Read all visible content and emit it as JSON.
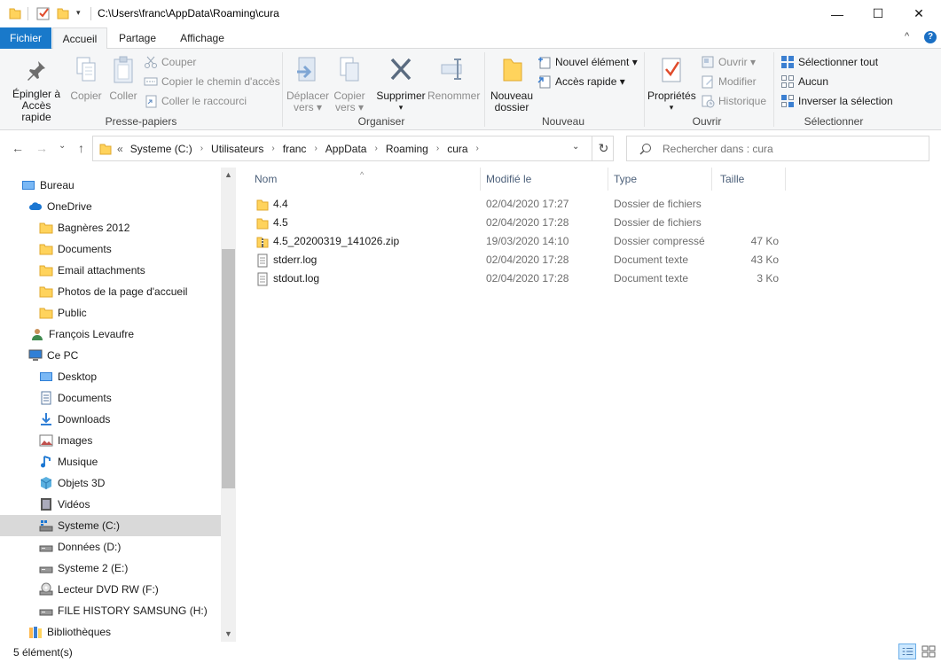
{
  "window": {
    "title": "C:\\Users\\franc\\AppData\\Roaming\\cura",
    "qa_dropdown": "▾",
    "minimize": "—",
    "maximize": "☐",
    "close": "✕"
  },
  "ribbon_tabs": {
    "file": "Fichier",
    "home": "Accueil",
    "share": "Partage",
    "view": "Affichage",
    "collapse": "^",
    "help": "?"
  },
  "ribbon": {
    "clipboard": {
      "label": "Presse-papiers",
      "pin_line1": "Épingler à",
      "pin_line2": "Accès rapide",
      "copy": "Copier",
      "paste": "Coller",
      "cut": "Couper",
      "copy_path": "Copier le chemin d'accès",
      "paste_shortcut": "Coller le raccourci"
    },
    "organize": {
      "label": "Organiser",
      "move_line1": "Déplacer",
      "move_line2": "vers ▾",
      "copyto_line1": "Copier",
      "copyto_line2": "vers ▾",
      "delete": "Supprimer",
      "delete_arrow": "▾",
      "rename": "Renommer"
    },
    "new": {
      "label": "Nouveau",
      "new_folder_line1": "Nouveau",
      "new_folder_line2": "dossier",
      "new_item": "Nouvel élément ▾",
      "easy_access": "Accès rapide ▾"
    },
    "open": {
      "label": "Ouvrir",
      "properties": "Propriétés",
      "properties_arrow": "▾",
      "open": "Ouvrir ▾",
      "edit": "Modifier",
      "history": "Historique"
    },
    "select": {
      "label": "Sélectionner",
      "select_all": "Sélectionner tout",
      "select_none": "Aucun",
      "invert": "Inverser la sélection"
    }
  },
  "nav": {
    "back": "←",
    "forward": "→",
    "recent": "⌄",
    "up": "↑",
    "overflow": "«",
    "crumbs": [
      "Systeme (C:)",
      "Utilisateurs",
      "franc",
      "AppData",
      "Roaming",
      "cura"
    ],
    "crumb_sep": "›",
    "dropdown": "⌄",
    "refresh": "↻",
    "search_placeholder": "Rechercher dans : cura"
  },
  "sidebar": {
    "items": [
      {
        "label": "Bureau",
        "icon": "desktop-icon"
      },
      {
        "label": "OneDrive",
        "icon": "cloud-icon"
      },
      {
        "label": "Bagnères 2012",
        "icon": "folder-icon"
      },
      {
        "label": "Documents",
        "icon": "folder-icon"
      },
      {
        "label": "Email attachments",
        "icon": "folder-icon"
      },
      {
        "label": "Photos de la page d'accueil",
        "icon": "folder-icon"
      },
      {
        "label": "Public",
        "icon": "folder-icon"
      },
      {
        "label": "François Levaufre",
        "icon": "user-icon"
      },
      {
        "label": "Ce PC",
        "icon": "computer-icon"
      },
      {
        "label": "Desktop",
        "icon": "desktop-icon"
      },
      {
        "label": "Documents",
        "icon": "documents-icon"
      },
      {
        "label": "Downloads",
        "icon": "download-icon"
      },
      {
        "label": "Images",
        "icon": "images-icon"
      },
      {
        "label": "Musique",
        "icon": "music-icon"
      },
      {
        "label": "Objets 3D",
        "icon": "cube-icon"
      },
      {
        "label": "Vidéos",
        "icon": "video-icon"
      },
      {
        "label": "Systeme (C:)",
        "icon": "windows-drive-icon"
      },
      {
        "label": "Données (D:)",
        "icon": "drive-icon"
      },
      {
        "label": "Systeme 2 (E:)",
        "icon": "drive-icon"
      },
      {
        "label": "Lecteur DVD RW (F:)",
        "icon": "dvd-icon"
      },
      {
        "label": "FILE HISTORY SAMSUNG (H:)",
        "icon": "drive-icon"
      },
      {
        "label": "Bibliothèques",
        "icon": "library-icon"
      }
    ],
    "scroll_up": "▲",
    "scroll_down": "▼"
  },
  "filelist": {
    "columns": {
      "name": "Nom",
      "modified": "Modifié le",
      "type": "Type",
      "size": "Taille"
    },
    "sort_arrow": "^",
    "rows": [
      {
        "name": "4.4",
        "modified": "02/04/2020 17:27",
        "type": "Dossier de fichiers",
        "size": "",
        "icon": "folder-icon"
      },
      {
        "name": "4.5",
        "modified": "02/04/2020 17:28",
        "type": "Dossier de fichiers",
        "size": "",
        "icon": "folder-icon"
      },
      {
        "name": "4.5_20200319_141026.zip",
        "modified": "19/03/2020 14:10",
        "type": "Dossier compressé",
        "size": "47 Ko",
        "icon": "zip-icon"
      },
      {
        "name": "stderr.log",
        "modified": "02/04/2020 17:28",
        "type": "Document texte",
        "size": "43 Ko",
        "icon": "text-file-icon"
      },
      {
        "name": "stdout.log",
        "modified": "02/04/2020 17:28",
        "type": "Document texte",
        "size": "3 Ko",
        "icon": "text-file-icon"
      }
    ]
  },
  "status": {
    "count": "5 élément(s)"
  },
  "colors": {
    "file_tab": "#1979ca",
    "selection": "#cce8ff",
    "folder_yellow": "#ffd35c"
  }
}
